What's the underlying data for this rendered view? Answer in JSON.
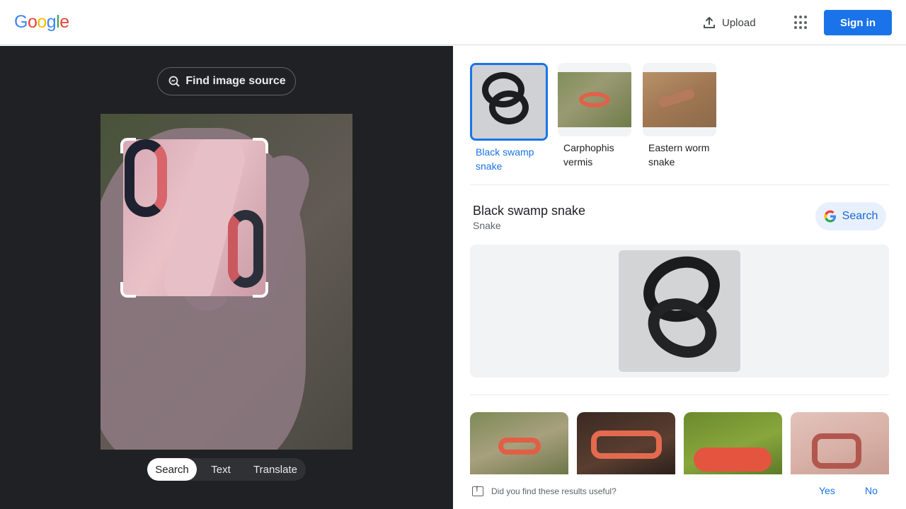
{
  "header": {
    "logo": [
      "G",
      "o",
      "o",
      "g",
      "l",
      "e"
    ],
    "logo_colors": [
      "#4285f4",
      "#ea4335",
      "#fbbc05",
      "#4285f4",
      "#34a853",
      "#ea4335"
    ],
    "upload_label": "Upload",
    "upload_icon": "upload-icon",
    "apps_icon": "apps-grid-icon",
    "sign_in_label": "Sign in"
  },
  "lens": {
    "find_image_source_label": "Find image source",
    "modes": [
      "Search",
      "Text",
      "Translate"
    ],
    "active_mode": "Search"
  },
  "results": {
    "candidates": [
      {
        "label": "Black swamp snake",
        "selected": true
      },
      {
        "label": "Carphophis vermis",
        "selected": false
      },
      {
        "label": "Eastern worm snake",
        "selected": false
      }
    ],
    "entity": {
      "title": "Black swamp snake",
      "subtitle": "Snake",
      "search_label": "Search"
    },
    "feedback": {
      "question": "Did you find these results useful?",
      "yes_label": "Yes",
      "no_label": "No"
    }
  },
  "colors": {
    "accent": "#1a73e8",
    "dark_pane": "#202124"
  }
}
